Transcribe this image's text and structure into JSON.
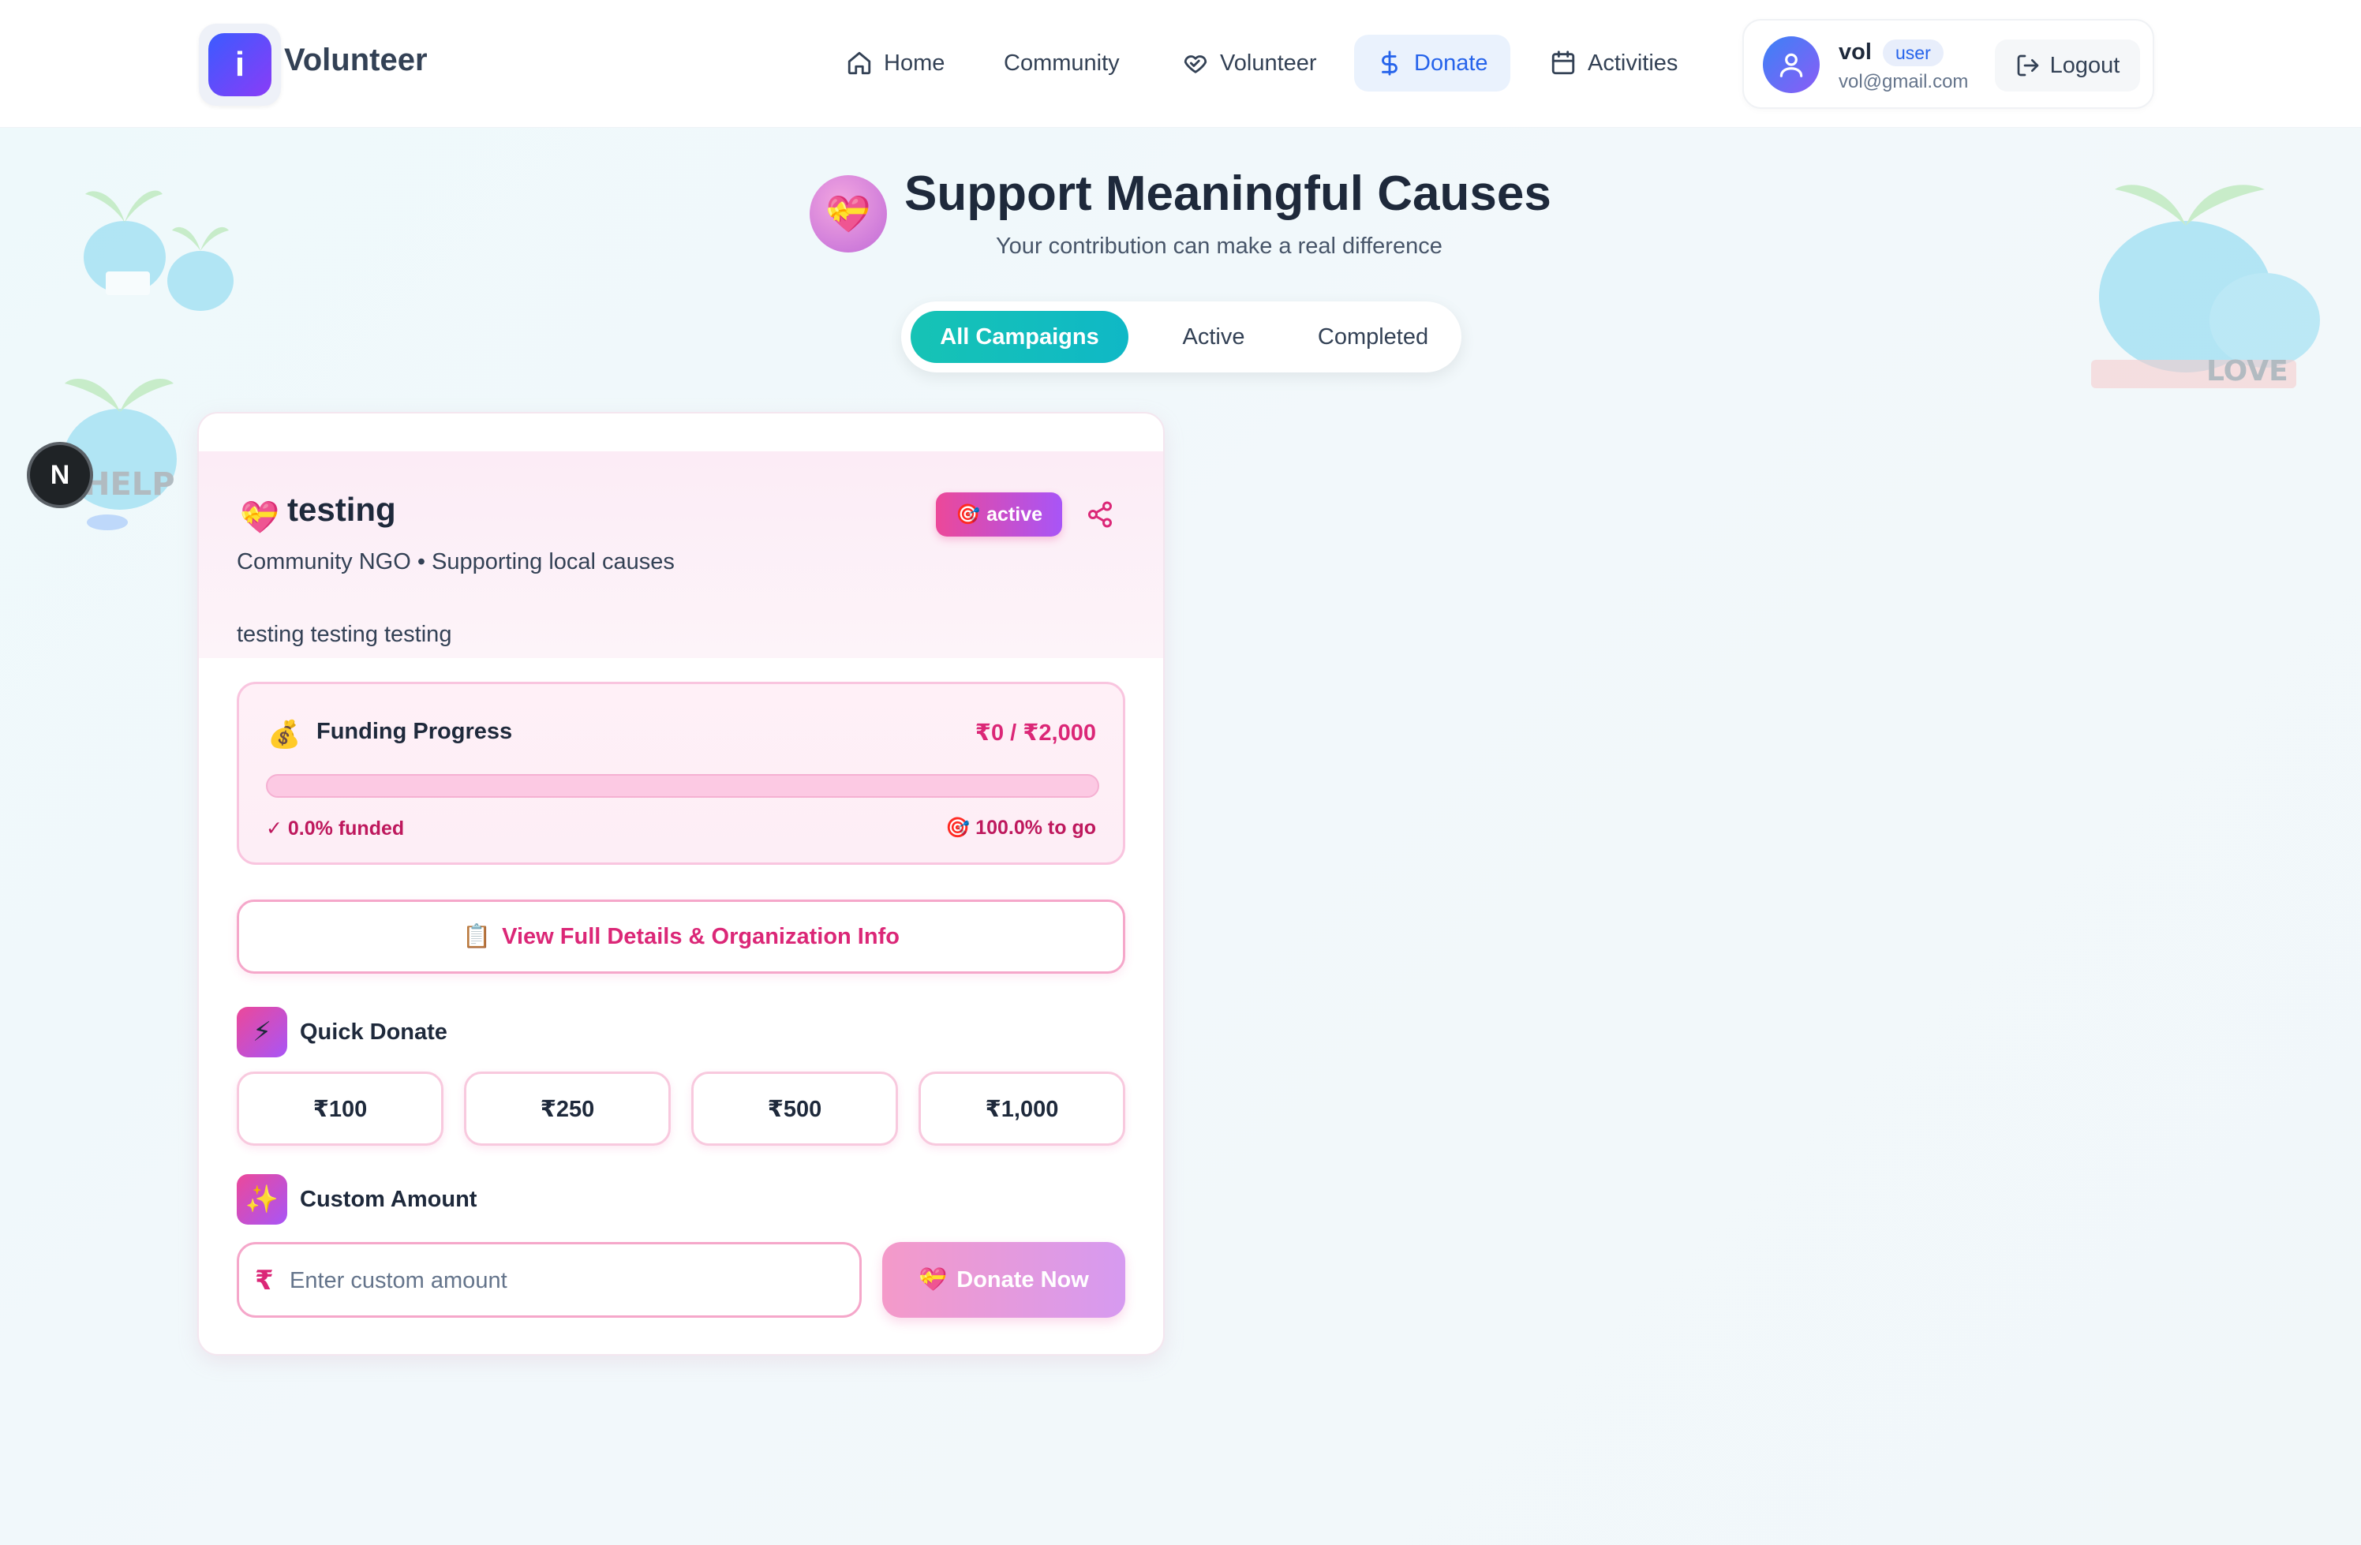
{
  "header": {
    "logo_letter": "i",
    "brand": "Volunteer",
    "nav": [
      {
        "label": "Home",
        "icon": "home-icon",
        "active": false
      },
      {
        "label": "Community",
        "icon": "",
        "active": false
      },
      {
        "label": "Volunteer",
        "icon": "heart-handshake-icon",
        "active": false
      },
      {
        "label": "Donate",
        "icon": "dollar-icon",
        "active": true
      },
      {
        "label": "Activities",
        "icon": "calendar-icon",
        "active": false
      }
    ],
    "user": {
      "name": "vol",
      "role": "user",
      "email": "vol@gmail.com"
    },
    "logout_label": "Logout"
  },
  "hero": {
    "icon": "💝",
    "title": "Support Meaningful Causes",
    "subtitle": "Your contribution can make a real difference"
  },
  "tabs": [
    {
      "label": "All Campaigns",
      "active": true
    },
    {
      "label": "Active",
      "active": false
    },
    {
      "label": "Completed",
      "active": false
    }
  ],
  "campaign": {
    "icon": "💝",
    "title": "testing",
    "status_icon": "🎯",
    "status": "active",
    "org_line": "Community NGO • Supporting local causes",
    "description": "testing testing testing",
    "funding": {
      "icon": "💰",
      "title": "Funding Progress",
      "amount": "₹0 / ₹2,000",
      "raised": 0,
      "goal": 2000,
      "progress_fraction": 0.0,
      "funded_text": "✓ 0.0% funded",
      "togo_text": "🎯 100.0% to go"
    },
    "details_icon": "📋",
    "details_label": "View Full Details & Organization Info",
    "quick_donate": {
      "icon": "⚡",
      "label": "Quick Donate",
      "amounts": [
        "₹100",
        "₹250",
        "₹500",
        "₹1,000"
      ]
    },
    "custom_amount": {
      "icon": "✨",
      "label": "Custom Amount",
      "currency_symbol": "₹",
      "placeholder": "Enter custom amount",
      "value": ""
    },
    "donate_icon": "💝",
    "donate_label": "Donate Now"
  },
  "dev_badge": "N",
  "decor": {
    "help_text": "HELP",
    "love_text": "LOVE"
  },
  "colors": {
    "primary_pink": "#ec4899",
    "accent_purple": "#a855f7",
    "teal_tab": "#16c3b5",
    "nav_active": "#2563eb"
  }
}
